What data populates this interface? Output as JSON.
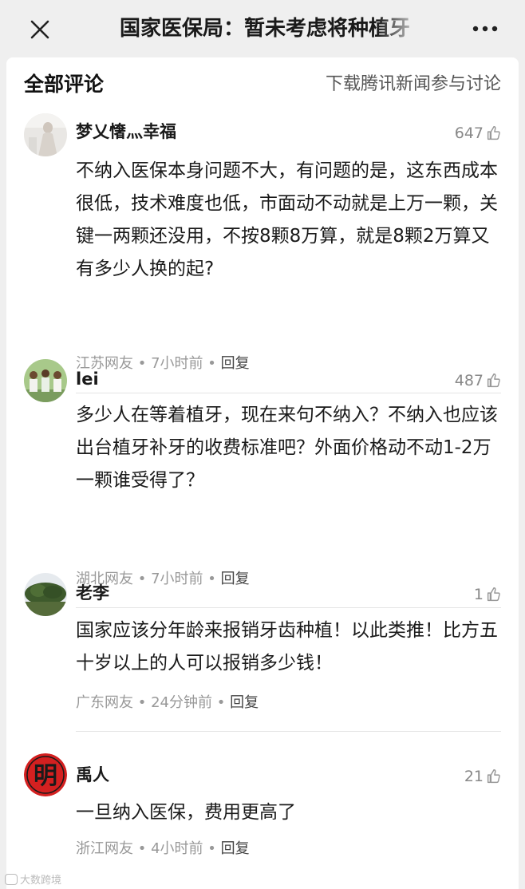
{
  "header": {
    "title": "国家医保局：暂未考虑将种植牙",
    "close_icon": "close-icon",
    "more_icon": "more-icon"
  },
  "section": {
    "title": "全部评论",
    "download_link": "下载腾讯新闻参与讨论"
  },
  "comments": [
    {
      "username": "梦乂㦋灬幸福",
      "likes": "647",
      "content": "不纳入医保本身问题不大，有问题的是，这东西成本很低，技术难度也低，市面动不动就是上万一颗，关键一两颗还没用，不按8颗8万算，就是8颗2万算又有多少人换的起?",
      "location": "江苏网友",
      "time": "7小时前",
      "reply": "回复"
    },
    {
      "username": "lei",
      "likes": "487",
      "content": "多少人在等着植牙，现在来句不纳入？不纳入也应该出台植牙补牙的收费标准吧？外面价格动不动1-2万一颗谁受得了？",
      "location": "湖北网友",
      "time": "7小时前",
      "reply": "回复"
    },
    {
      "username": "老李",
      "likes": "1",
      "content": "国家应该分年龄来报销牙齿种植！以此类推！比方五十岁以上的人可以报销多少钱！",
      "location": "广东网友",
      "time": "24分钟前",
      "reply": "回复"
    },
    {
      "username": "禹人",
      "likes": "21",
      "content": "一旦纳入医保，费用更高了",
      "location": "浙江网友",
      "time": "4小时前",
      "reply": "回复"
    }
  ],
  "avatar_badge_char": "明",
  "watermark": "大数跨境",
  "separator": "•",
  "colors": {
    "background": "#efefef",
    "card": "#ffffff",
    "meta_text": "#999999",
    "avatar_red": "#d42020"
  }
}
